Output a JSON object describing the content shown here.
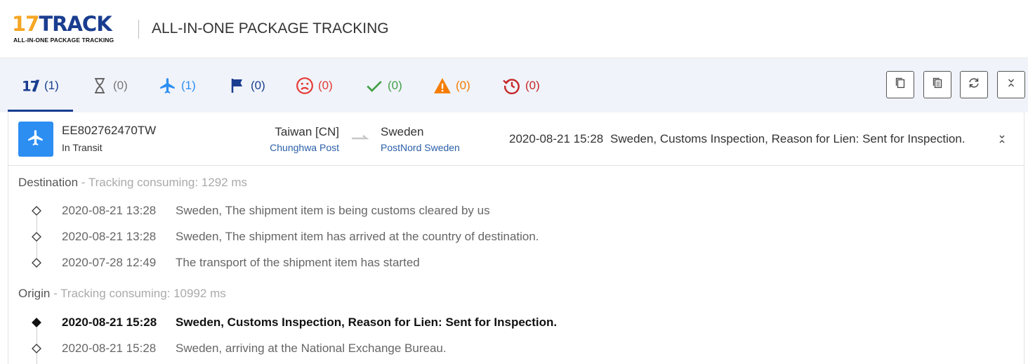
{
  "header": {
    "logo_num": "17",
    "logo_word": "TRACK",
    "logo_tagline": "ALL-IN-ONE PACKAGE TRACKING",
    "title": "ALL-IN-ONE PACKAGE TRACKING"
  },
  "tabs": [
    {
      "icon": "17-logo-icon",
      "count": "(1)",
      "color": "#1a3d8f"
    },
    {
      "icon": "hourglass-icon",
      "count": "(0)",
      "color": "#777777"
    },
    {
      "icon": "airplane-icon",
      "count": "(1)",
      "color": "#2d8ef2"
    },
    {
      "icon": "flag-icon",
      "count": "(0)",
      "color": "#1a3d8f"
    },
    {
      "icon": "sad-face-icon",
      "count": "(0)",
      "color": "#e53935"
    },
    {
      "icon": "checkmark-icon",
      "count": "(0)",
      "color": "#43a047"
    },
    {
      "icon": "warning-icon",
      "count": "(0)",
      "color": "#f57c00"
    },
    {
      "icon": "history-icon",
      "count": "(0)",
      "color": "#c62828"
    }
  ],
  "toolbar": [
    "copy-icon",
    "copy-all-icon",
    "refresh-icon",
    "collapse-icon"
  ],
  "shipment": {
    "tracking_number": "EE802762470TW",
    "status": "In Transit",
    "origin_country": "Taiwan [CN]",
    "origin_carrier": "Chunghwa Post",
    "destination_country": "Sweden",
    "destination_carrier": "PostNord Sweden",
    "latest_time": "2020-08-21 15:28",
    "latest_event": "Sweden, Customs Inspection, Reason for Lien: Sent for Inspection."
  },
  "destination": {
    "label": "Destination",
    "meta": " - Tracking consuming: 1292 ms",
    "events": [
      {
        "time": "2020-08-21 13:28",
        "desc": "Sweden, The shipment item is being customs cleared by us"
      },
      {
        "time": "2020-08-21 13:28",
        "desc": "Sweden, The shipment item has arrived at the country of destination."
      },
      {
        "time": "2020-07-28 12:49",
        "desc": "The transport of the shipment item has started"
      }
    ]
  },
  "origin": {
    "label": "Origin",
    "meta": " - Tracking consuming: 10992 ms",
    "events": [
      {
        "time": "2020-08-21 15:28",
        "desc": "Sweden, Customs Inspection, Reason for Lien: Sent for Inspection.",
        "latest": true
      },
      {
        "time": "2020-08-21 15:28",
        "desc": "Sweden, arriving at the National Exchange Bureau.",
        "latest": false
      }
    ]
  }
}
